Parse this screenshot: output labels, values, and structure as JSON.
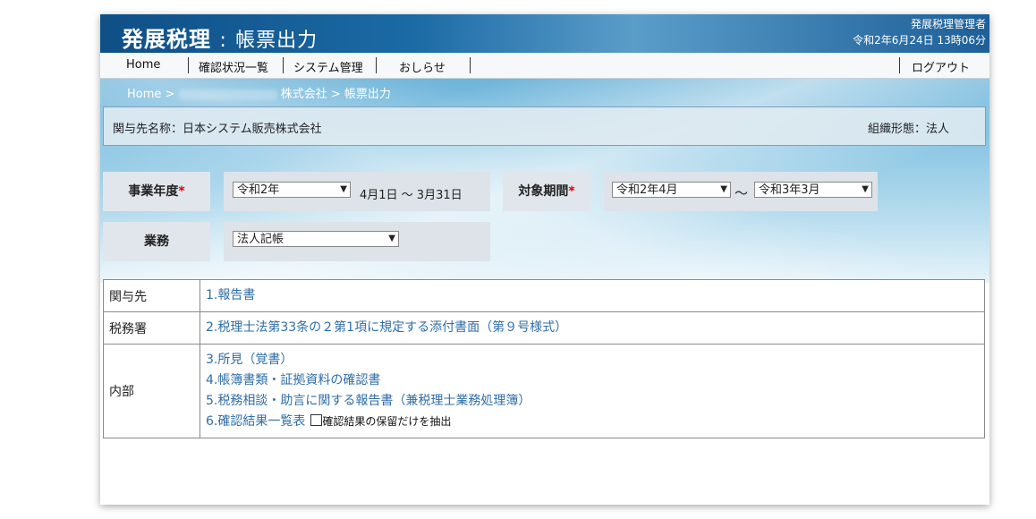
{
  "header": {
    "app_name": "発展税理",
    "separator": ":",
    "page_name": "帳票出力",
    "user": "発展税理管理者",
    "datetime": "令和2年6月24日 13時06分"
  },
  "menu": {
    "home": "Home",
    "items": [
      "確認状況一覧",
      "システム管理",
      "おしらせ"
    ],
    "logout": "ログアウト"
  },
  "breadcrumb": {
    "home": "Home",
    "sep1": ">",
    "company": "株式会社",
    "sep2": ">",
    "current": "帳票出力"
  },
  "client": {
    "label": "関与先名称：日本システム販売株式会社",
    "org": "組織形態：法人"
  },
  "form": {
    "fiscal_year_label": "事業年度",
    "fiscal_year_value": "令和2年",
    "fiscal_year_range": "4月1日 ～ 3月31日",
    "period_label": "対象期間",
    "period_from": "令和2年4月",
    "period_tilde": "～",
    "period_to": "令和3年3月",
    "business_label": "業務",
    "business_value": "法人記帳",
    "required_mark": "*"
  },
  "docs": {
    "rows": [
      {
        "category": "関与先",
        "items": [
          "1.報告書"
        ]
      },
      {
        "category": "税務署",
        "items": [
          "2.税理士法第33条の２第1項に規定する添付書面（第９号様式）"
        ]
      },
      {
        "category": "内部",
        "items": [
          "3.所見（覚書）",
          "4.帳簿書類・証拠資料の確認書",
          "5.税務相談・助言に関する報告書（兼税理士業務処理簿）",
          "6.確認結果一覧表"
        ]
      }
    ],
    "checkbox_label": "確認結果の保留だけを抽出"
  }
}
